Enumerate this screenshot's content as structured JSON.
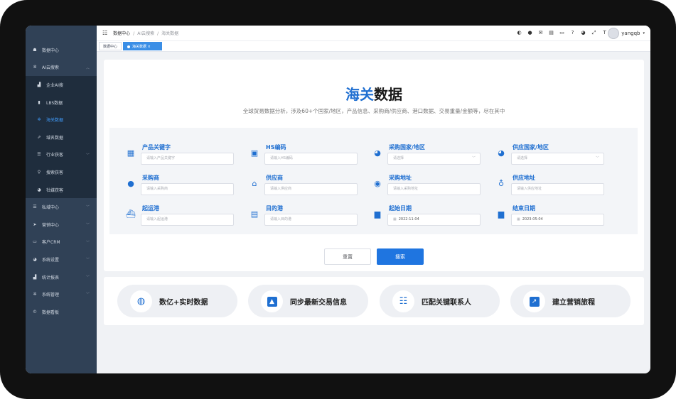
{
  "sidebar": {
    "items": [
      {
        "label": "数据中心",
        "icon": "dashboard-icon",
        "has_children": false
      },
      {
        "label": "AI云搜索",
        "icon": "gear-icon",
        "has_children": true,
        "expanded": true,
        "children": [
          {
            "label": "企业AI搜",
            "icon": "building-icon",
            "active": false
          },
          {
            "label": "LBS数据",
            "icon": "map-book-icon",
            "active": false
          },
          {
            "label": "海关数据",
            "icon": "gear-icon",
            "active": true
          },
          {
            "label": "域名数据",
            "icon": "external-link-icon",
            "active": false
          },
          {
            "label": "行业获客",
            "icon": "list-icon",
            "active": false,
            "has_children": true
          },
          {
            "label": "搜索获客",
            "icon": "search-icon",
            "active": false
          },
          {
            "label": "社媒获客",
            "icon": "globe-icon",
            "active": false
          }
        ]
      },
      {
        "label": "私域中心",
        "icon": "list-icon",
        "has_children": true
      },
      {
        "label": "营销中心",
        "icon": "send-icon",
        "has_children": true
      },
      {
        "label": "客户CRM",
        "icon": "crm-icon",
        "has_children": true
      },
      {
        "label": "系统设置",
        "icon": "globe-icon",
        "has_children": true
      },
      {
        "label": "统计报表",
        "icon": "bar-chart-icon",
        "has_children": true
      },
      {
        "label": "系统管理",
        "icon": "gear-icon",
        "has_children": true
      },
      {
        "label": "数据看板",
        "icon": "copyright-icon",
        "has_children": false
      }
    ]
  },
  "breadcrumb": {
    "items": [
      "数据中心",
      "AI云搜索",
      "海关数据"
    ]
  },
  "user": {
    "name": "yangqb"
  },
  "tags": {
    "home": "数据中心",
    "current": "海关数据",
    "close": "×"
  },
  "page": {
    "title_highlight": "海关",
    "title_rest": "数据",
    "subtitle": "全球贸易数据分析，涉及60+个国家/地区，产品信息、采购商/供应商、港口数据、交易重量/金额等，尽在其中"
  },
  "fields": [
    {
      "label": "产品关键字",
      "placeholder": "请输入产品关键字",
      "icon": "document-icon"
    },
    {
      "label": "HS编码",
      "placeholder": "请输入HS编码",
      "icon": "terminal-icon"
    },
    {
      "label": "采购国家/地区",
      "placeholder": "请选择",
      "icon": "globe-icon",
      "select": true
    },
    {
      "label": "供应国家/地区",
      "placeholder": "请选择",
      "icon": "globe-icon",
      "select": true
    },
    {
      "label": "采购商",
      "placeholder": "请输入采购商",
      "icon": "user-icon"
    },
    {
      "label": "供应商",
      "placeholder": "请输入供应商",
      "icon": "store-icon"
    },
    {
      "label": "采购地址",
      "placeholder": "请输入采购地址",
      "icon": "location-pin-icon"
    },
    {
      "label": "供应地址",
      "placeholder": "请输入供应地址",
      "icon": "map-pin-icon"
    },
    {
      "label": "起运港",
      "placeholder": "请输入起运港",
      "icon": "ship-icon"
    },
    {
      "label": "目的港",
      "placeholder": "请输入目的港",
      "icon": "train-icon"
    },
    {
      "label": "起始日期",
      "value": "2022-11-04",
      "icon": "calendar-icon",
      "date": true
    },
    {
      "label": "结束日期",
      "value": "2023-05-04",
      "icon": "calendar-icon",
      "date": true
    }
  ],
  "buttons": {
    "reset": "重置",
    "search": "搜索"
  },
  "features": [
    {
      "label": "数亿+实时数据",
      "icon": "globe-icon"
    },
    {
      "label": "同步最新交易信息",
      "icon": "contact-card-icon"
    },
    {
      "label": "匹配关键联系人",
      "icon": "contacts-icon"
    },
    {
      "label": "建立营销旅程",
      "icon": "trend-chart-icon"
    }
  ],
  "colors": {
    "accent": "#1f6fd1",
    "sidebar": "#304156",
    "sidebar_sub": "#1f2d3d",
    "active": "#409eff"
  }
}
